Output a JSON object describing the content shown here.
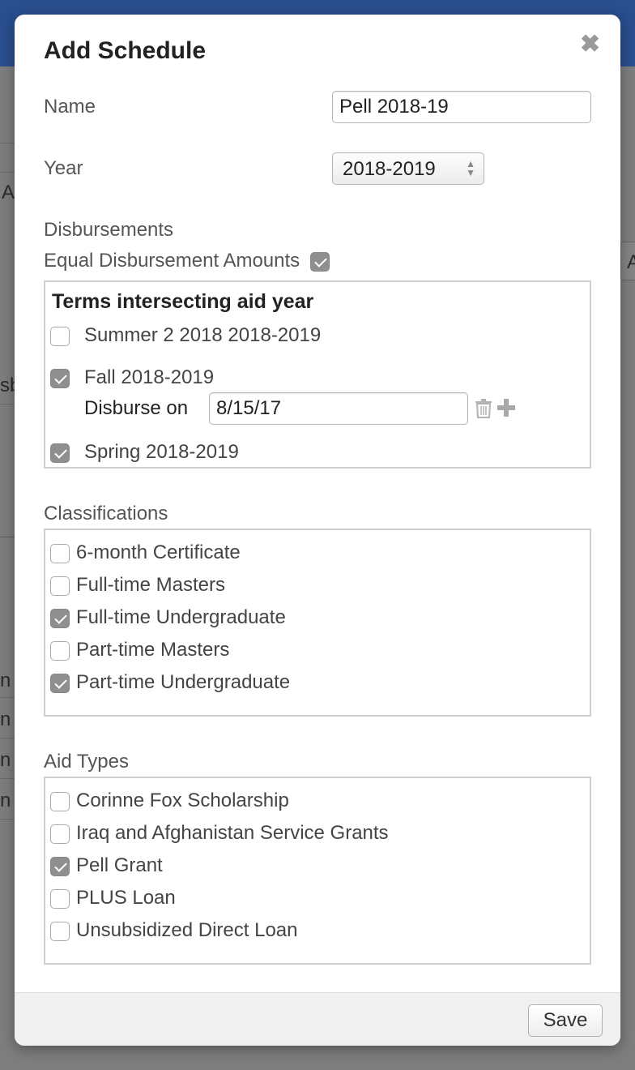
{
  "background": {
    "fragments": [
      "A",
      "A",
      "sb",
      "n",
      "n S",
      "n",
      "n F"
    ]
  },
  "modal": {
    "title": "Add Schedule",
    "close_icon": "close-icon",
    "name": {
      "label": "Name",
      "value": "Pell 2018-19"
    },
    "year": {
      "label": "Year",
      "value": "2018-2019"
    },
    "disbursements": {
      "label": "Disbursements",
      "equal_amounts_label": "Equal Disbursement Amounts",
      "equal_amounts_checked": true,
      "terms_heading": "Terms intersecting aid year",
      "terms": [
        {
          "label": "Summer 2 2018 2018-2019",
          "checked": false
        },
        {
          "label": "Fall 2018-2019",
          "checked": true
        },
        {
          "label": "Spring 2018-2019",
          "checked": true
        }
      ],
      "disburse_on_label": "Disburse on",
      "disburse_on_value": "8/15/17",
      "delete_icon": "trash-icon",
      "add_icon": "plus-icon"
    },
    "classifications": {
      "label": "Classifications",
      "items": [
        {
          "label": "6-month Certificate",
          "checked": false
        },
        {
          "label": "Full-time Masters",
          "checked": false
        },
        {
          "label": "Full-time Undergraduate",
          "checked": true
        },
        {
          "label": "Part-time Masters",
          "checked": false
        },
        {
          "label": "Part-time Undergraduate",
          "checked": true
        }
      ]
    },
    "aid_types": {
      "label": "Aid Types",
      "items": [
        {
          "label": "Corinne Fox Scholarship",
          "checked": false
        },
        {
          "label": "Iraq and Afghanistan Service Grants",
          "checked": false
        },
        {
          "label": "Pell Grant",
          "checked": true
        },
        {
          "label": "PLUS Loan",
          "checked": false
        },
        {
          "label": "Unsubsidized Direct Loan",
          "checked": false
        }
      ]
    },
    "footer": {
      "save_label": "Save"
    }
  }
}
